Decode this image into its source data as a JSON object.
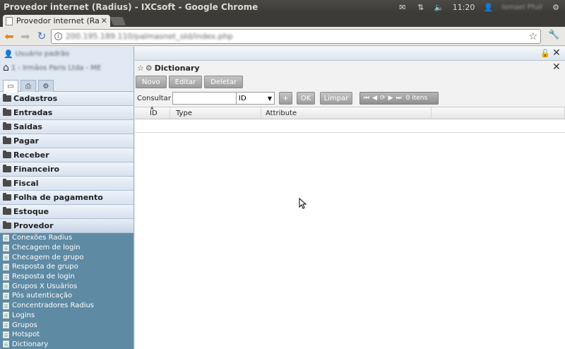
{
  "os": {
    "window_title": "Provedor internet (Radius) - IXCsoft - Google Chrome",
    "clock": "11:20",
    "user": "Ismael Pfuil"
  },
  "browser": {
    "tab_title": "Provedor internet (Radius",
    "url": "200.195.189.110/palmasnet_old/index.php"
  },
  "sidebar": {
    "user": "Usuário padrão",
    "company": "1 - Irmãos Paris Ltda - ME",
    "menu": [
      "Cadastros",
      "Entradas",
      "Saidas",
      "Pagar",
      "Receber",
      "Financeiro",
      "Fiscal",
      "Folha de pagamento",
      "Estoque",
      "Provedor"
    ],
    "provedor_items": [
      "Conexões Radius",
      "Checagem de login",
      "Checagem de grupo",
      "Resposta de grupo",
      "Resposta de login",
      "Grupos X Usuários",
      "Pós autenticação",
      "Concentradores Radius",
      "Logins",
      "Grupos",
      "Hotspot",
      "Dictionary"
    ]
  },
  "panel": {
    "title": "Dictionary",
    "buttons": {
      "novo": "Novo",
      "editar": "Editar",
      "deletar": "Deletar"
    },
    "search": {
      "label": "Consultar",
      "value": "",
      "field": "ID",
      "plus": "+",
      "ok": "OK",
      "limpar": "Limpar"
    },
    "pager": {
      "count": "0 itens"
    },
    "columns": [
      "ID",
      "Type",
      "Attribute"
    ]
  }
}
